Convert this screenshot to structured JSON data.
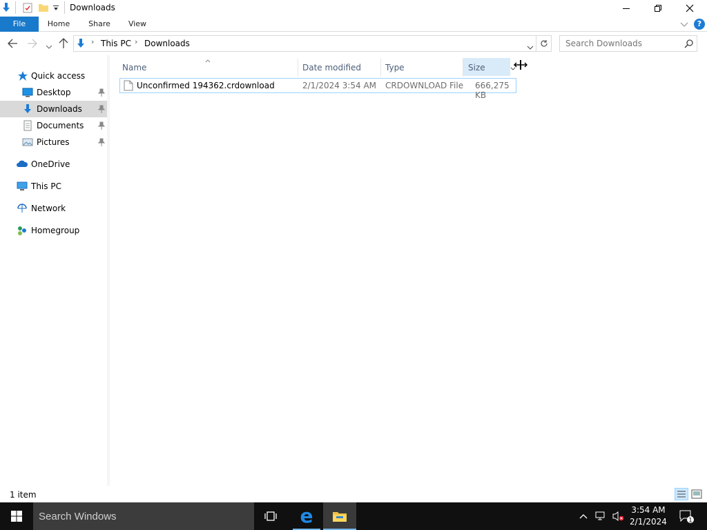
{
  "window": {
    "title": "Downloads"
  },
  "ribbon": {
    "tabs": [
      "File",
      "Home",
      "Share",
      "View"
    ]
  },
  "address": {
    "crumbs": [
      "This PC",
      "Downloads"
    ]
  },
  "search": {
    "placeholder": "Search Downloads"
  },
  "nav": {
    "quick_access": "Quick access",
    "items": [
      {
        "label": "Desktop",
        "pinned": true
      },
      {
        "label": "Downloads",
        "pinned": true,
        "selected": true
      },
      {
        "label": "Documents",
        "pinned": true
      },
      {
        "label": "Pictures",
        "pinned": true
      }
    ],
    "onedrive": "OneDrive",
    "thispc": "This PC",
    "network": "Network",
    "homegroup": "Homegroup"
  },
  "columns": {
    "name": "Name",
    "date": "Date modified",
    "type": "Type",
    "size": "Size"
  },
  "files": [
    {
      "name": "Unconfirmed 194362.crdownload",
      "date": "2/1/2024 3:54 AM",
      "type": "CRDOWNLOAD File",
      "size": "666,275 KB"
    }
  ],
  "status": {
    "count": "1 item"
  },
  "taskbar": {
    "search": "Search Windows",
    "time": "3:54 AM",
    "date": "2/1/2024"
  },
  "colors": {
    "accent": "#1979ca",
    "selection": "#d9d9d9",
    "taskbar": "#101010"
  }
}
